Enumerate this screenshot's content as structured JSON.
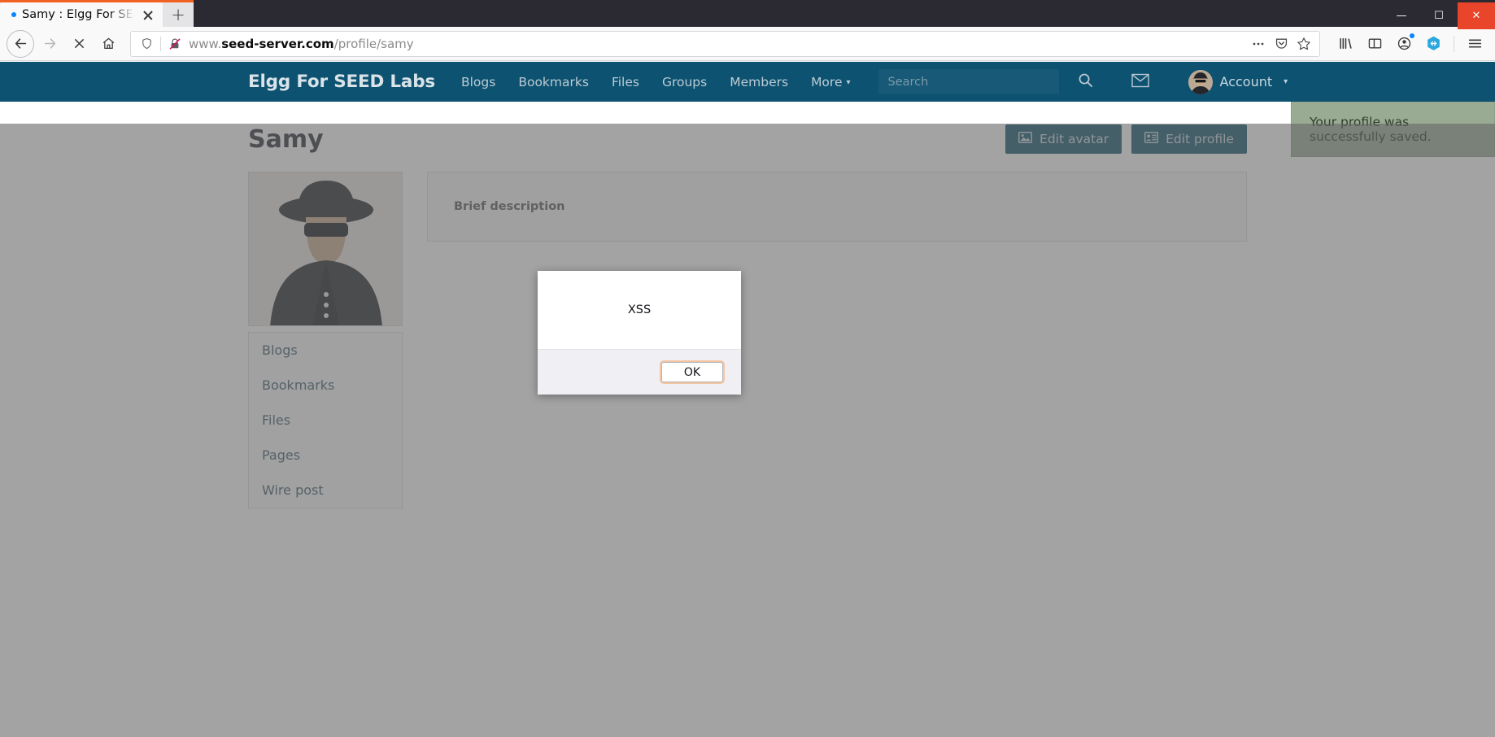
{
  "browser": {
    "tab": {
      "title": "Samy : Elgg For SEED Labs",
      "close_label": ""
    },
    "new_tab_label": "+",
    "window_controls": {
      "minimize": "—",
      "maximize": "☐",
      "close": "✕"
    },
    "nav": {
      "back": "back-arrow",
      "forward": "forward-arrow",
      "stop": "stop-x",
      "home": "home"
    },
    "url": {
      "prefix": "www.",
      "domain": "seed-server.com",
      "path": "/profile/samy"
    },
    "urlbar_icons": [
      "shield-icon",
      "broken-lock-icon",
      "ellipsis-icon",
      "pocket-icon",
      "star-icon"
    ],
    "toolbar_icons": [
      "library-icon",
      "sidebar-icon",
      "account-icon",
      "container-icon",
      "hamburger-menu-icon"
    ]
  },
  "site": {
    "logo": "Elgg For SEED Labs",
    "nav": [
      {
        "label": "Blogs"
      },
      {
        "label": "Bookmarks"
      },
      {
        "label": "Files"
      },
      {
        "label": "Groups"
      },
      {
        "label": "Members"
      },
      {
        "label": "More",
        "has_caret": true
      }
    ],
    "search": {
      "value": "",
      "placeholder": "Search"
    },
    "account": {
      "label": "Account",
      "has_caret": true
    }
  },
  "notification": {
    "text": "Your profile was successfully saved."
  },
  "profile": {
    "title": "Samy",
    "actions": [
      {
        "label": "Edit avatar",
        "icon": "image-icon"
      },
      {
        "label": "Edit profile",
        "icon": "contact-card-icon"
      }
    ],
    "sidebar_menu": [
      {
        "label": "Blogs"
      },
      {
        "label": "Bookmarks"
      },
      {
        "label": "Files"
      },
      {
        "label": "Pages"
      },
      {
        "label": "Wire post"
      }
    ],
    "brief_description_label": "Brief description",
    "brief_description_value": ""
  },
  "alert": {
    "message": "XSS",
    "ok_label": "OK"
  },
  "colors": {
    "accent": "#0d5271",
    "button": "#14566f",
    "notification_bg": "#9aab93",
    "tab_accent": "#f06122",
    "focus_ring": "#f3c6a3"
  }
}
